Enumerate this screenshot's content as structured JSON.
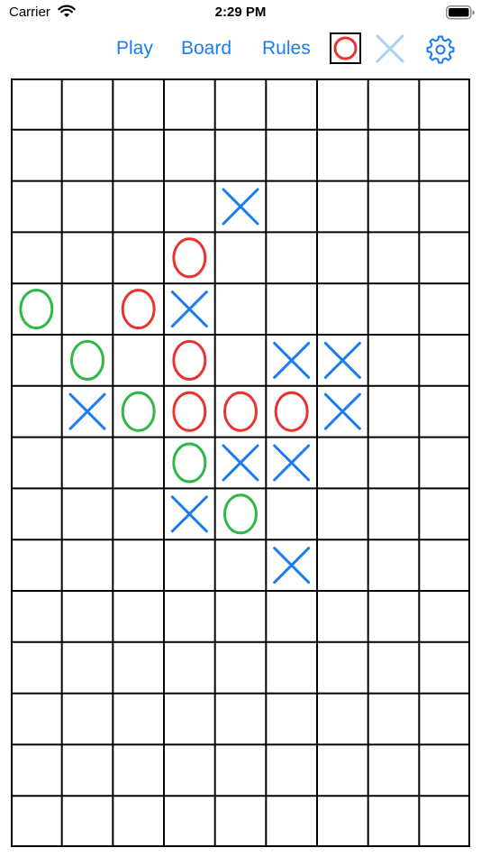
{
  "status_bar": {
    "carrier": "Carrier",
    "time": "2:29 PM"
  },
  "toolbar": {
    "play_label": "Play",
    "board_label": "Board",
    "rules_label": "Rules",
    "selected_player": "O",
    "accent_color": "#1a7cf0"
  },
  "board": {
    "columns": 9,
    "rows": 15,
    "colors": {
      "O_red": "#e8332e",
      "O_green": "#2fb845",
      "X": "#1a7cf0",
      "grid": "#000000"
    },
    "pieces": [
      {
        "row": 2,
        "col": 4,
        "mark": "X",
        "color": "X"
      },
      {
        "row": 3,
        "col": 3,
        "mark": "O",
        "color": "O_red"
      },
      {
        "row": 4,
        "col": 0,
        "mark": "O",
        "color": "O_green"
      },
      {
        "row": 4,
        "col": 2,
        "mark": "O",
        "color": "O_red"
      },
      {
        "row": 4,
        "col": 3,
        "mark": "X",
        "color": "X"
      },
      {
        "row": 5,
        "col": 1,
        "mark": "O",
        "color": "O_green"
      },
      {
        "row": 5,
        "col": 3,
        "mark": "O",
        "color": "O_red"
      },
      {
        "row": 5,
        "col": 5,
        "mark": "X",
        "color": "X"
      },
      {
        "row": 5,
        "col": 6,
        "mark": "X",
        "color": "X"
      },
      {
        "row": 6,
        "col": 1,
        "mark": "X",
        "color": "X"
      },
      {
        "row": 6,
        "col": 2,
        "mark": "O",
        "color": "O_green"
      },
      {
        "row": 6,
        "col": 3,
        "mark": "O",
        "color": "O_red"
      },
      {
        "row": 6,
        "col": 4,
        "mark": "O",
        "color": "O_red"
      },
      {
        "row": 6,
        "col": 5,
        "mark": "O",
        "color": "O_red"
      },
      {
        "row": 6,
        "col": 6,
        "mark": "X",
        "color": "X"
      },
      {
        "row": 7,
        "col": 3,
        "mark": "O",
        "color": "O_green"
      },
      {
        "row": 7,
        "col": 4,
        "mark": "X",
        "color": "X"
      },
      {
        "row": 7,
        "col": 5,
        "mark": "X",
        "color": "X"
      },
      {
        "row": 8,
        "col": 3,
        "mark": "X",
        "color": "X"
      },
      {
        "row": 8,
        "col": 4,
        "mark": "O",
        "color": "O_green"
      },
      {
        "row": 9,
        "col": 5,
        "mark": "X",
        "color": "X"
      }
    ]
  }
}
